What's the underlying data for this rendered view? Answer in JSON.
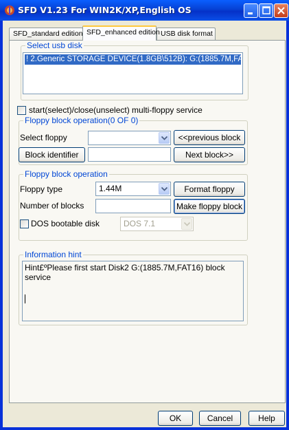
{
  "window": {
    "title": "SFD V1.23 For WIN2K/XP,English OS"
  },
  "tabs": [
    {
      "label": "SFD_standard edition"
    },
    {
      "label": "SFD_enhanced edition"
    },
    {
      "label": "USB disk format"
    }
  ],
  "usb": {
    "legend": "Select usb disk",
    "selected_item": "! 2.Generic STORAGE DEVICE(1.8GB\\512B): G:(1885.7M,FA"
  },
  "multi_floppy_service": {
    "label": "start(select)/close(unselect) multi-floppy service",
    "checked": false
  },
  "block_op": {
    "legend": "Floppy block operation(0 OF 0)",
    "select_floppy_label": "Select floppy",
    "select_floppy_value": "",
    "previous_button": "<<previous block",
    "block_identifier_button": "Block identifier",
    "block_identifier_value": "",
    "next_button": "Next block>>"
  },
  "floppy_op": {
    "legend": "Floppy block operation",
    "floppy_type_label": "Floppy type",
    "floppy_type_value": "1.44M",
    "format_button": "Format floppy",
    "number_blocks_label": "Number of blocks",
    "number_blocks_value": "",
    "make_button": "Make floppy block",
    "dos_bootable_label": "DOS bootable disk",
    "dos_bootable_checked": false,
    "dos_version": "DOS 7.1"
  },
  "hint": {
    "legend": "Information hint",
    "line1": "Hint£ºPlease first start Disk2 G:(1885.7M,FAT16)   block",
    "line2": "service"
  },
  "footer": {
    "ok": "OK",
    "cancel": "Cancel",
    "help": "Help"
  }
}
